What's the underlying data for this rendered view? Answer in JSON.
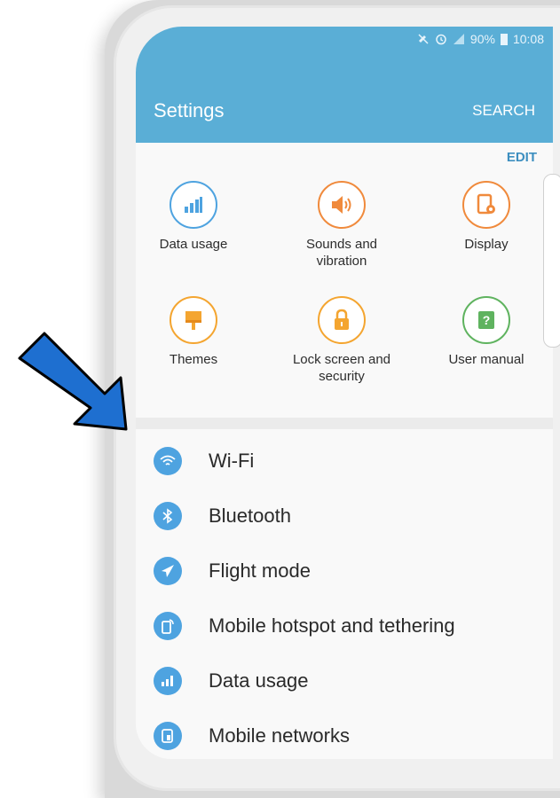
{
  "status": {
    "battery": "90%",
    "time": "10:08"
  },
  "appbar": {
    "title": "Settings",
    "search": "SEARCH"
  },
  "quick": {
    "edit": "EDIT",
    "items": [
      {
        "label": "Data usage",
        "color": "#4ea3e0",
        "icon": "data-usage-icon"
      },
      {
        "label": "Sounds and vibration",
        "color": "#f08a3c",
        "icon": "speaker-icon"
      },
      {
        "label": "Display",
        "color": "#f08a3c",
        "icon": "display-icon"
      },
      {
        "label": "Themes",
        "color": "#f4a530",
        "icon": "theme-brush-icon"
      },
      {
        "label": "Lock screen and security",
        "color": "#f4a530",
        "icon": "lock-icon"
      },
      {
        "label": "User manual",
        "color": "#5fb35f",
        "icon": "user-manual-icon"
      }
    ]
  },
  "list": [
    {
      "label": "Wi-Fi",
      "icon": "wifi-icon"
    },
    {
      "label": "Bluetooth",
      "icon": "bluetooth-icon"
    },
    {
      "label": "Flight mode",
      "icon": "airplane-icon"
    },
    {
      "label": "Mobile hotspot and tethering",
      "icon": "hotspot-icon"
    },
    {
      "label": "Data usage",
      "icon": "data-usage-icon"
    },
    {
      "label": "Mobile networks",
      "icon": "mobile-network-icon"
    }
  ],
  "colors": {
    "appbar": "#5aaed6",
    "accent": "#3d8fc0",
    "arrow": "#1e6fd0"
  }
}
